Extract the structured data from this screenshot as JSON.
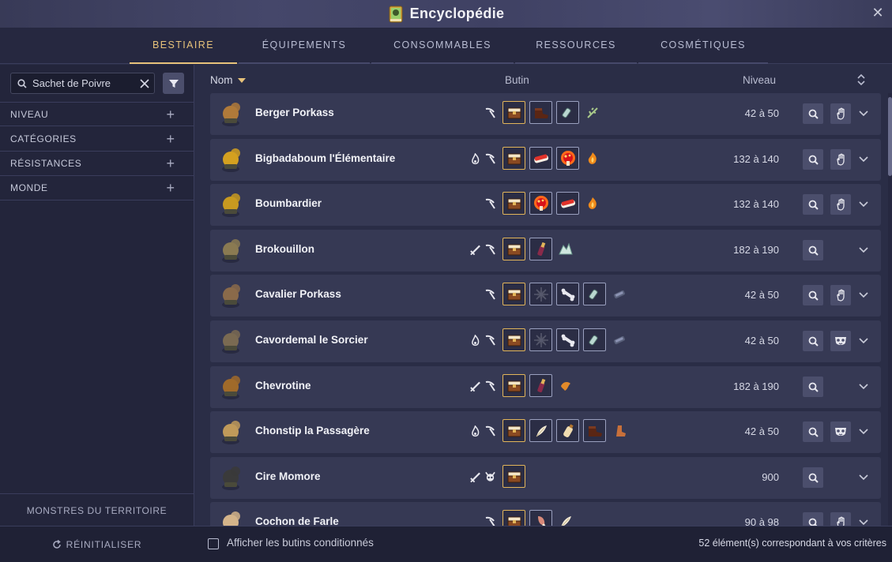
{
  "window": {
    "title": "Encyclopédie"
  },
  "tabs": [
    {
      "label": "BESTIAIRE",
      "active": true
    },
    {
      "label": "ÉQUIPEMENTS",
      "active": false
    },
    {
      "label": "CONSOMMABLES",
      "active": false
    },
    {
      "label": "RESSOURCES",
      "active": false
    },
    {
      "label": "COSMÉTIQUES",
      "active": false
    }
  ],
  "sidebar": {
    "search_value": "Sachet de Poivre",
    "filters": [
      {
        "label": "NIVEAU"
      },
      {
        "label": "CATÉGORIES"
      },
      {
        "label": "RÉSISTANCES"
      },
      {
        "label": "MONDE"
      }
    ],
    "territory_label": "MONSTRES DU TERRITOIRE"
  },
  "columns": {
    "nom": "Nom",
    "butin": "Butin",
    "niveau": "Niveau"
  },
  "colors": {
    "accent": "#e7c27a",
    "row_bg": "#363954",
    "gold_border": "#e2b55a"
  },
  "rows": [
    {
      "name": "Berger Porkass",
      "level": "42 à 50",
      "tags": [
        "pickaxe"
      ],
      "loot": [
        "chest",
        "boot",
        "potion",
        "herb"
      ],
      "type": "hand"
    },
    {
      "name": "Bigbadaboum l'Élémentaire",
      "level": "132 à 140",
      "tags": [
        "fire",
        "pickaxe"
      ],
      "loot": [
        "chest",
        "sushi",
        "mushroom",
        "flame"
      ],
      "type": "hand-mask"
    },
    {
      "name": "Boumbardier",
      "level": "132 à 140",
      "tags": [
        "pickaxe"
      ],
      "loot": [
        "chest",
        "mushroom",
        "sushi",
        "flame"
      ],
      "type": "hand"
    },
    {
      "name": "Brokouillon",
      "level": "182 à 190",
      "tags": [
        "sword",
        "pickaxe"
      ],
      "loot": [
        "chest",
        "bottle",
        "crystal"
      ],
      "type": "none"
    },
    {
      "name": "Cavalier Porkass",
      "level": "42 à 50",
      "tags": [
        "pickaxe"
      ],
      "loot": [
        "chest",
        "spike",
        "bone",
        "potion",
        "scroll"
      ],
      "type": "hand"
    },
    {
      "name": "Cavordemal le Sorcier",
      "level": "42 à 50",
      "tags": [
        "fire",
        "pickaxe"
      ],
      "loot": [
        "chest",
        "spike",
        "bone",
        "potion",
        "scroll"
      ],
      "type": "mask"
    },
    {
      "name": "Chevrotine",
      "level": "182 à 190",
      "tags": [
        "sword",
        "pickaxe"
      ],
      "loot": [
        "chest",
        "bottle",
        "leaf"
      ],
      "type": "none"
    },
    {
      "name": "Chonstip la Passagère",
      "level": "42 à 50",
      "tags": [
        "fire",
        "pickaxe"
      ],
      "loot": [
        "chest",
        "feather",
        "bottle2",
        "boot",
        "boot2"
      ],
      "type": "mask"
    },
    {
      "name": "Cire Momore",
      "level": "900",
      "tags": [
        "sword",
        "skull"
      ],
      "loot": [
        "chest"
      ],
      "type": "none"
    },
    {
      "name": "Cochon de Farle",
      "level": "90 à 98",
      "tags": [
        "pickaxe"
      ],
      "loot": [
        "chest",
        "meat",
        "feather"
      ],
      "type": "hand"
    }
  ],
  "footer": {
    "reset_label": "RÉINITIALISER",
    "conditional_label": "Afficher les butins conditionnés",
    "count_text": "52 élément(s) correspondant à vos critères"
  }
}
